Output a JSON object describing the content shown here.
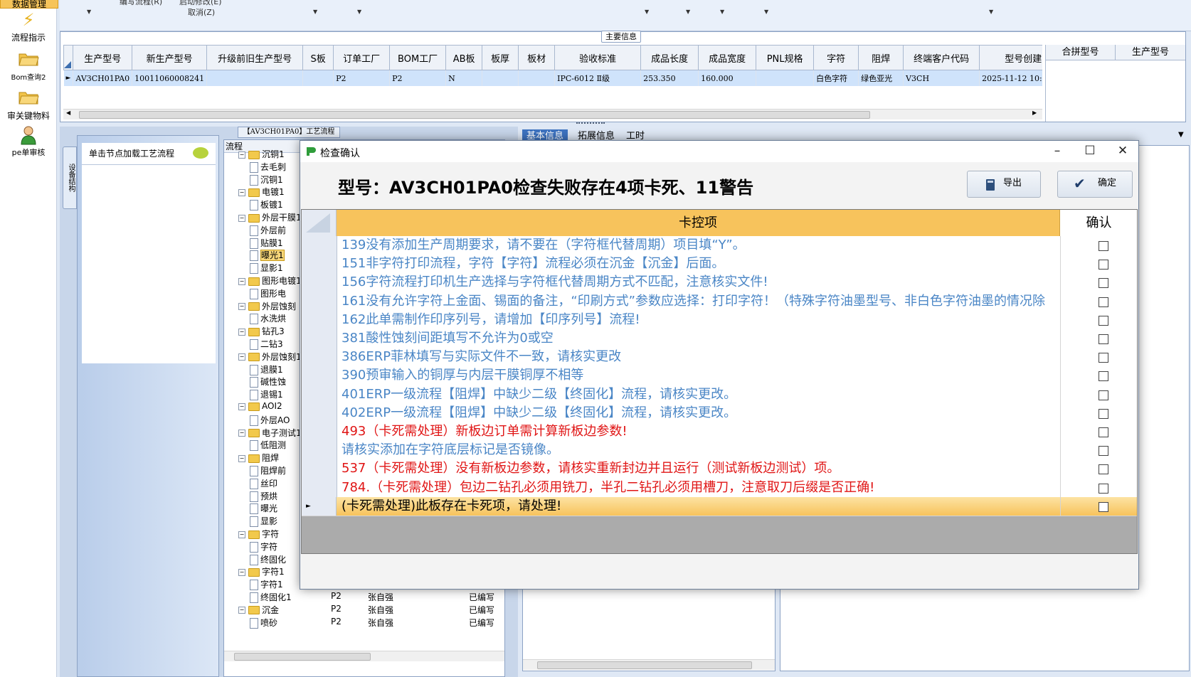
{
  "left_toolbar": {
    "items": [
      {
        "label": "数据管理",
        "icon": "folder-icon"
      },
      {
        "label": "流程指示",
        "icon": "lightning-icon"
      },
      {
        "label": "Bom查询2",
        "icon": "folder-open-icon"
      },
      {
        "label": "审关键物料",
        "icon": "folder-open-icon"
      },
      {
        "label": "pe单审核",
        "icon": "user-icon"
      }
    ]
  },
  "top_bar": {
    "item1": "编写流程(R)",
    "item2": "启动修改(E)",
    "item3": "取消(Z)"
  },
  "main_info": {
    "group_title": "主要信息",
    "columns": [
      "生产型号",
      "新生产型号",
      "升级前旧生产型号",
      "S板",
      "订单工厂",
      "BOM工厂",
      "AB板",
      "板厚",
      "板材",
      "验收标准",
      "成品长度",
      "成品宽度",
      "PNL规格",
      "字符",
      "阻焊",
      "终端客户代码",
      "型号创建"
    ],
    "row": [
      "AV3CH01PA0",
      "10011060008241",
      "",
      "",
      "P2",
      "P2",
      "N",
      "",
      "",
      "IPC-6012 Ⅱ级",
      "253.350",
      "160.000",
      "",
      "白色字符",
      "绿色亚光",
      "V3CH",
      "2025-11-12 10:39:44"
    ],
    "right_columns": [
      "合拼型号",
      "生产型号"
    ]
  },
  "process_panel": {
    "title": "【AV3CH01PA0】工艺流程",
    "side_tab": "设备结构",
    "node_hint": "单击节点加载工艺流程",
    "tree_header": "流程",
    "tree": [
      {
        "label": "沉铜1",
        "level": 0
      },
      {
        "label": "去毛刺",
        "level": 1
      },
      {
        "label": "沉铜1",
        "level": 1
      },
      {
        "label": "电镀1",
        "level": 0
      },
      {
        "label": "板镀1",
        "level": 1
      },
      {
        "label": "外层干膜1",
        "level": 0
      },
      {
        "label": "外层前",
        "level": 1
      },
      {
        "label": "贴膜1",
        "level": 1
      },
      {
        "label": "曝光1",
        "level": 1
      },
      {
        "label": "显影1",
        "level": 1
      },
      {
        "label": "图形电镀1",
        "level": 0
      },
      {
        "label": "图形电",
        "level": 1
      },
      {
        "label": "外层蚀刻",
        "level": 0
      },
      {
        "label": "水洗烘",
        "level": 1
      },
      {
        "label": "钻孔3",
        "level": 0
      },
      {
        "label": "二钻3",
        "level": 1
      },
      {
        "label": "外层蚀刻1",
        "level": 0
      },
      {
        "label": "退膜1",
        "level": 1
      },
      {
        "label": "碱性蚀",
        "level": 1
      },
      {
        "label": "退锡1",
        "level": 1
      },
      {
        "label": "AOI2",
        "level": 0
      },
      {
        "label": "外层AO",
        "level": 1
      },
      {
        "label": "电子测试1",
        "level": 0
      },
      {
        "label": "低阻测",
        "level": 1
      },
      {
        "label": "阻焊",
        "level": 0
      },
      {
        "label": "阻焊前",
        "level": 1
      },
      {
        "label": "丝印",
        "level": 1
      },
      {
        "label": "预烘",
        "level": 1
      },
      {
        "label": "曝光",
        "level": 1
      },
      {
        "label": "显影",
        "level": 1
      },
      {
        "label": "字符",
        "level": 0
      },
      {
        "label": "字符",
        "level": 1
      },
      {
        "label": "终固化",
        "level": 1
      },
      {
        "label": "字符1",
        "level": 0
      },
      {
        "label": "字符1",
        "level": 1
      },
      {
        "label": "终固化1",
        "level": 1
      },
      {
        "label": "沉金",
        "level": 0
      },
      {
        "label": "喷砂",
        "level": 1
      }
    ],
    "extra_rows": [
      {
        "code": "P2",
        "user": "张自强",
        "status": "已编写"
      },
      {
        "code": "P2",
        "user": "张自强",
        "status": "已编写"
      },
      {
        "code": "P2",
        "user": "张自强",
        "status": "已编写"
      },
      {
        "code": "P2",
        "user": "张自强",
        "status": "已编写"
      },
      {
        "code": "P2",
        "user": "张自强",
        "status": "已编写"
      },
      {
        "code": "P2",
        "user": "张自强",
        "status": "已编写"
      }
    ]
  },
  "right_tabs": [
    "基本信息",
    "拓展信息",
    "工时"
  ],
  "dialog": {
    "title": "检查确认",
    "heading": "型号：AV3CH01PA0检查失败存在4项卡死、11警告",
    "export_label": "导出",
    "confirm_label": "确定",
    "col_item": "卡控项",
    "col_confirm": "确认",
    "rows": [
      {
        "text": "139没有添加生产周期要求，请不要在（字符框代替周期）项目填“Y”。",
        "style": "warn"
      },
      {
        "text": "151非字符打印流程，字符【字符】流程必须在沉金【沉金】后面。",
        "style": "warn"
      },
      {
        "text": "156字符流程打印机生产选择与字符框代替周期方式不匹配，注意核实文件!",
        "style": "warn"
      },
      {
        "text": "161没有允许字符上金面、锡面的备注，“印刷方式”参数应选择：打印字符！（特殊字符油墨型号、非白色字符油墨的情况除外）",
        "style": "warn"
      },
      {
        "text": "162此单需制作印序列号，请增加【印序列号】流程!",
        "style": "warn"
      },
      {
        "text": "381酸性蚀刻间距填写不允许为0或空",
        "style": "warn"
      },
      {
        "text": "386ERP菲林填写与实际文件不一致，请核实更改",
        "style": "warn"
      },
      {
        "text": "390预审输入的铜厚与内层干膜铜厚不相等",
        "style": "warn"
      },
      {
        "text": "401ERP一级流程【阻焊】中缺少二级【终固化】流程，请核实更改。",
        "style": "warn"
      },
      {
        "text": "402ERP一级流程【阻焊】中缺少二级【终固化】流程，请核实更改。",
        "style": "warn"
      },
      {
        "text": "493（卡死需处理）新板边订单需计算新板边参数!",
        "style": "fatal"
      },
      {
        "text": "请核实添加在字符底层标记是否镜像。",
        "style": "warn"
      },
      {
        "text": "537（卡死需处理）没有新板边参数，请核实重新封边并且运行（测试新板边测试）项。",
        "style": "fatal"
      },
      {
        "text": "784.（卡死需处理）包边二钻孔必须用铣刀，半孔二钻孔必须用槽刀，注意取刀后缀是否正确!",
        "style": "fatal"
      },
      {
        "text": "(卡死需处理)此板存在卡死项，请处理!",
        "style": "current"
      }
    ]
  },
  "colors": {
    "warn": "#4a86c6",
    "fatal": "#e01515",
    "header_orange": "#f7c35c",
    "selection_blue": "#cfe3fb"
  }
}
